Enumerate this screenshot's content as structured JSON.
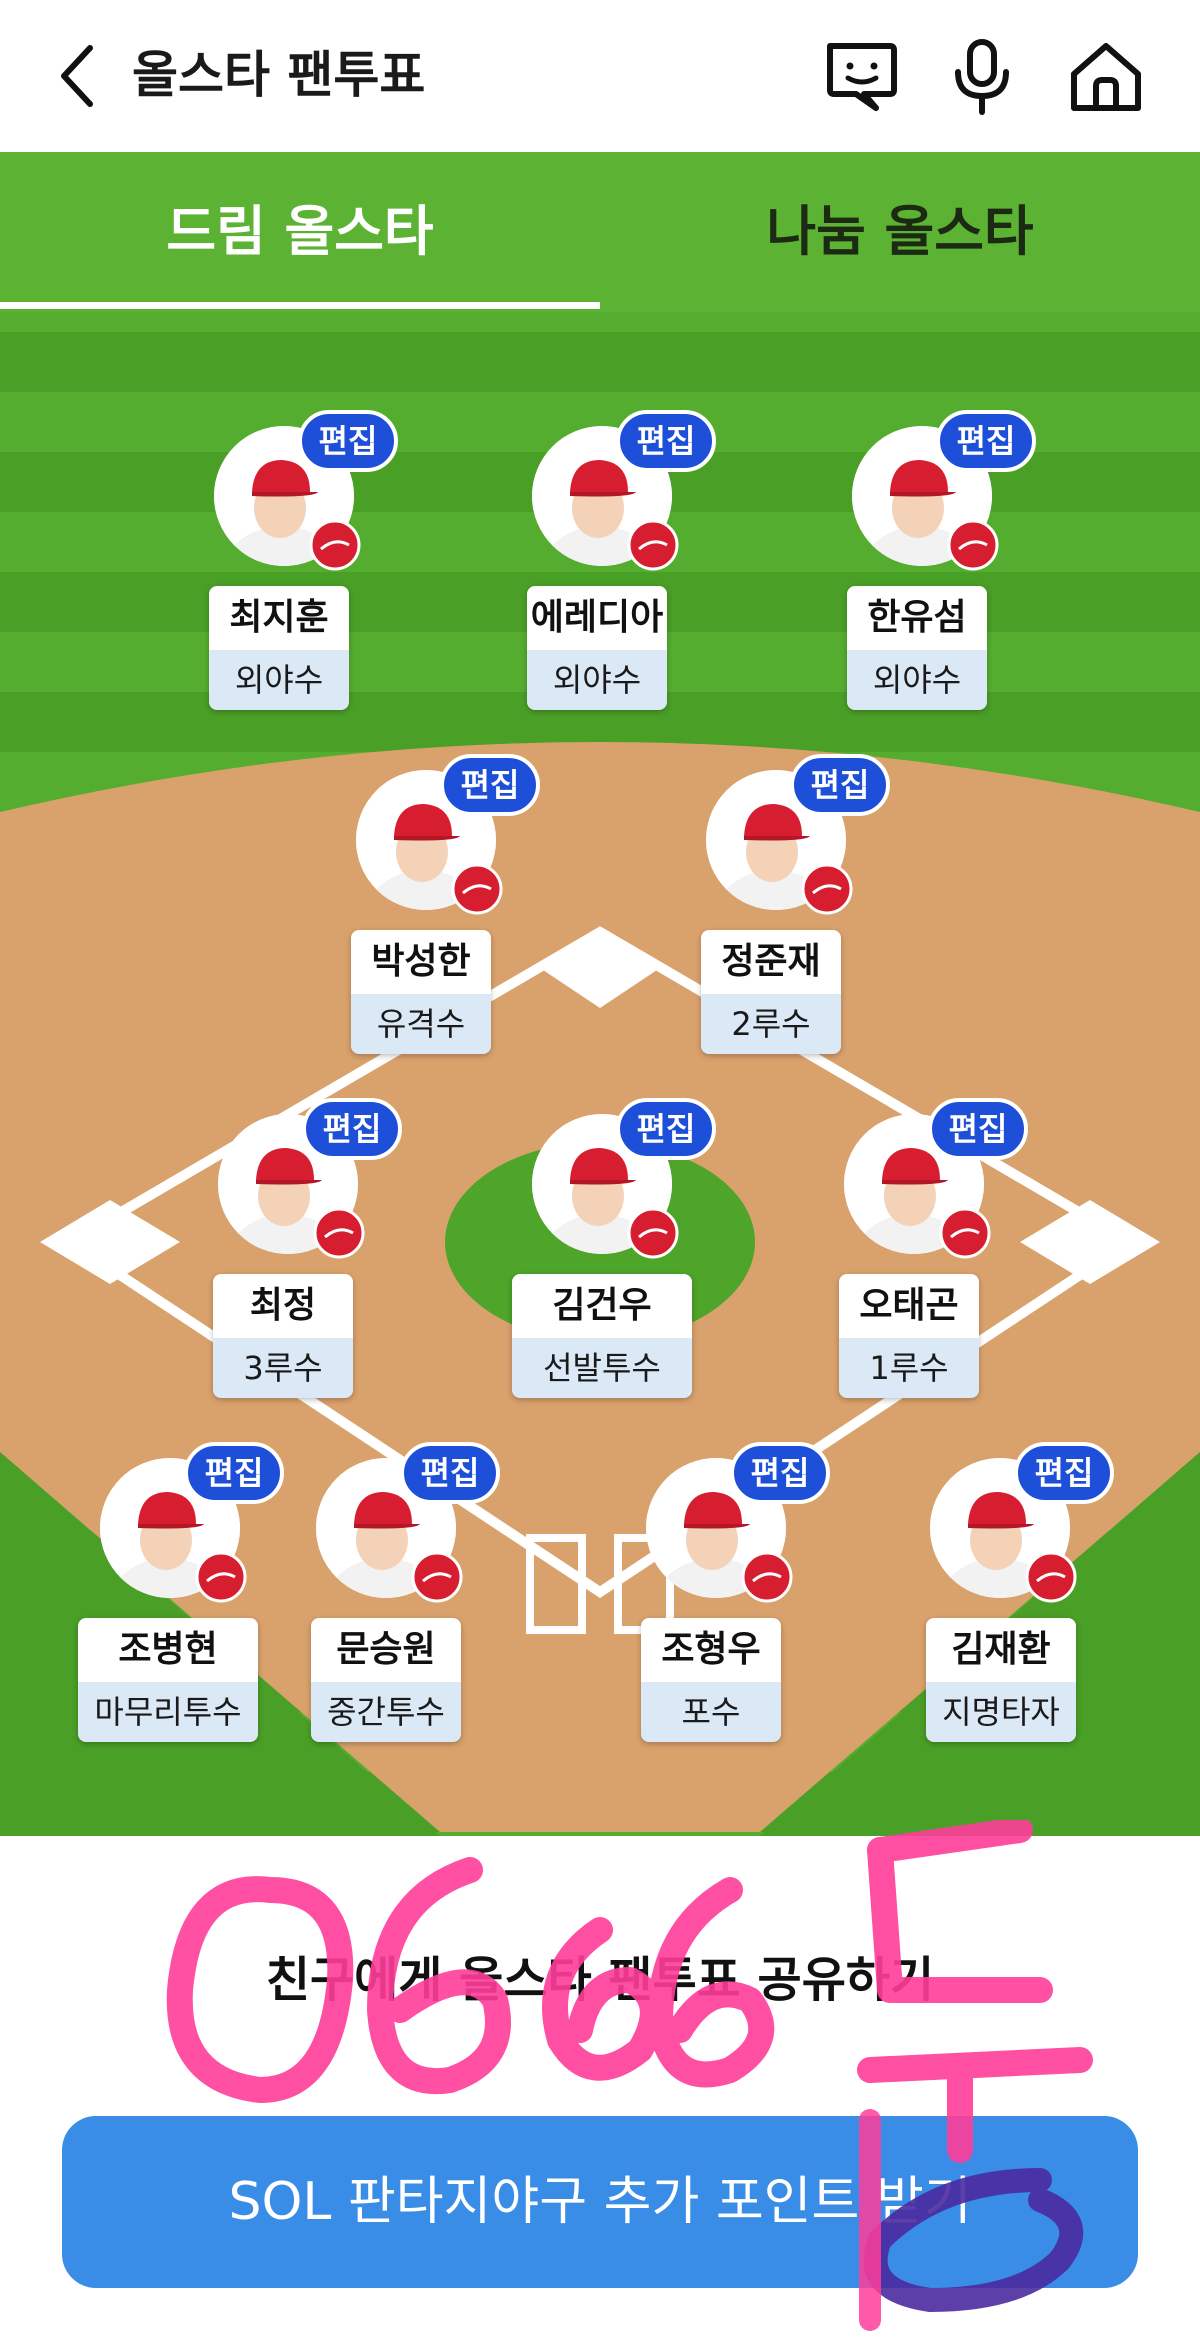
{
  "header": {
    "title": "올스타 팬투표",
    "icons": [
      "back-chevron-icon",
      "chat-bot-icon",
      "microphone-icon",
      "home-icon"
    ]
  },
  "tabs": [
    {
      "label": "드림 올스타",
      "active": true
    },
    {
      "label": "나눔 올스타",
      "active": false
    }
  ],
  "edit_label": "편집",
  "players": [
    {
      "name": "최지훈",
      "position": "외야수"
    },
    {
      "name": "에레디아",
      "position": "외야수"
    },
    {
      "name": "한유섬",
      "position": "외야수"
    },
    {
      "name": "박성한",
      "position": "유격수"
    },
    {
      "name": "정준재",
      "position": "2루수"
    },
    {
      "name": "최정",
      "position": "3루수"
    },
    {
      "name": "김건우",
      "position": "선발투수"
    },
    {
      "name": "오태곤",
      "position": "1루수"
    },
    {
      "name": "조병현",
      "position": "마무리투수"
    },
    {
      "name": "문승원",
      "position": "중간투수"
    },
    {
      "name": "조형우",
      "position": "포수"
    },
    {
      "name": "김재환",
      "position": "지명타자"
    }
  ],
  "share_text": "친구에게 올스타 팬투표 공유하기",
  "cta_label": "SOL 판타지야구 추가 포인트 받기",
  "colors": {
    "grass": "#4ea52a",
    "dirt": "#d9a16c",
    "edit_badge": "#1d4fd8",
    "cta": "#3a8de6",
    "position_bg": "#dbe9f7",
    "scribble_pink": "#ff3d9a",
    "scribble_purple": "#4a2aa0"
  }
}
